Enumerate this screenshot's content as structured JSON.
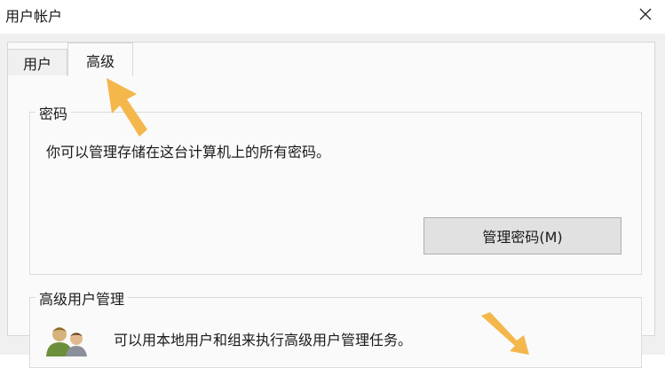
{
  "window": {
    "title": "用户帐户"
  },
  "tabs": [
    {
      "label": "用户",
      "selected": false
    },
    {
      "label": "高级",
      "selected": true
    }
  ],
  "password_group": {
    "title": "密码",
    "description": "你可以管理存储在这台计算机上的所有密码。",
    "manage_button": "管理密码(M)"
  },
  "advanced_group": {
    "title": "高级用户管理",
    "description": "可以用本地用户和组来执行高级用户管理任务。"
  },
  "colors": {
    "annotation_arrow": "#f3b74c",
    "button_bg": "#e1e1e1",
    "panel_bg": "#fafafa",
    "window_bg": "#f0f0f0"
  },
  "icons": {
    "close": "close-icon",
    "users": "users-group-icon",
    "arrow": "annotation-arrow-icon"
  }
}
